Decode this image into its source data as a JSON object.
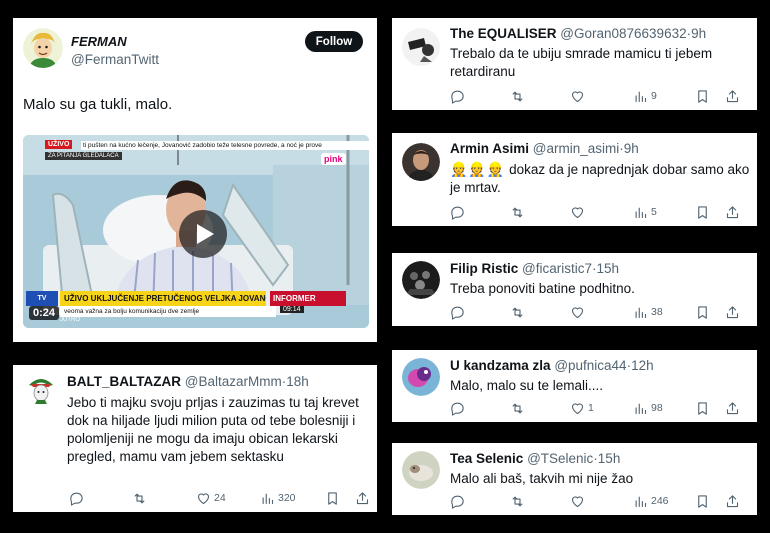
{
  "main_tweet": {
    "name": "FERMAN",
    "handle": "@FermanTwitt",
    "follow_label": "Follow",
    "text": "Malo su ga tukli, malo.",
    "video": {
      "live_tag": "UŽIVO",
      "ticker_top": "ti pušten na kućno lečenje, Jovanović zadobio teže telesne povrede, a noć je prove",
      "ticker_sub": "ZA PITANJA GLEDALACA",
      "pink_logo": "pink",
      "lower_third": "UŽIVO UKLJUČENJE PRETUČENOG VELJKA JOVANOVIĆA",
      "informer": "INFORMER",
      "clock": "09:14",
      "ticker_bottom": "veoma važna za bolju komunikaciju dve zemlje",
      "timecode": "0:24",
      "channel": "JUTRO"
    }
  },
  "left_reply": {
    "name": "BALT_BALTAZAR",
    "handle": "@BaltazarMmm",
    "time": "18h",
    "text": "Jebo ti majku svoju prljas i zauzimas tu taj krevet dok na hiljade ljudi  milion puta od tebe bolesniji i polomljeniji ne mogu da imaju obican lekarski pregled, mamu vam jebem sektasku",
    "likes": "24",
    "views": "320"
  },
  "replies": [
    {
      "name": "The EQUALISER",
      "handle": "@Goran0876639632",
      "time": "9h",
      "text": "Trebalo da te ubiju smrade mamicu ti jebem retardiranu",
      "likes": "",
      "views": "9"
    },
    {
      "name": "Armin Asimi",
      "handle": "@armin_asimi",
      "time": "9h",
      "emoji": "👷👷👷",
      "text": "dokaz da je naprednjak dobar samo ako je mrtav.",
      "likes": "",
      "views": "5"
    },
    {
      "name": "Filip Ristic",
      "handle": "@ficaristic7",
      "time": "15h",
      "text": "Treba ponoviti batine podhitno.",
      "likes": "",
      "views": "38"
    },
    {
      "name": "U kandzama zla",
      "handle": "@pufnica44",
      "time": "12h",
      "text": "Malo, malo su te lemali....",
      "likes": "1",
      "views": "98"
    },
    {
      "name": "Tea Selenic",
      "handle": "@TSelenic",
      "time": "15h",
      "text": "Malo ali baš, takvih mi nije žao",
      "likes": "",
      "views": "246"
    }
  ],
  "icons": [
    "reply-icon",
    "retweet-icon",
    "like-icon",
    "views-icon",
    "bookmark-icon",
    "share-icon",
    "play-icon"
  ],
  "colors": {
    "background": "#000000",
    "card": "#ffffff",
    "name": "#0f1419",
    "muted": "#536471",
    "follow_bg": "#0f1419"
  }
}
